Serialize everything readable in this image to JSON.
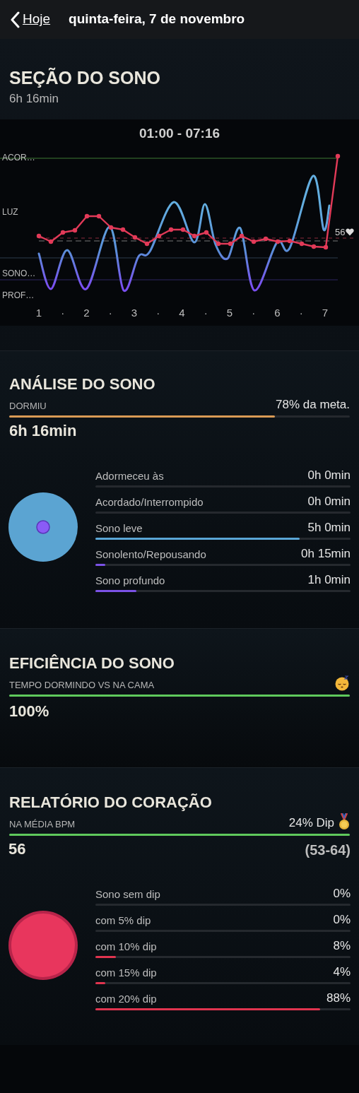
{
  "header": {
    "back_label": "Hoje",
    "title": "quinta-feira, 7 de novembro"
  },
  "sleep_session": {
    "title": "SEÇÃO DO SONO",
    "duration": "6h 16min",
    "chart": {
      "time_range": "01:00 - 07:16",
      "stage_labels": [
        "ACOR…",
        "LUZ",
        "SONO…",
        "PROF…"
      ],
      "x_labels": [
        "1",
        "·",
        "2",
        "·",
        "3",
        "·",
        "4",
        "·",
        "5",
        "·",
        "6",
        "·",
        "7"
      ],
      "heart_reading": "56"
    }
  },
  "sleep_analysis": {
    "title": "ANÁLISE DO SONO",
    "label": "DORMIU",
    "goal": "78% da meta.",
    "level": 0.78,
    "total": "6h 16min",
    "rows": [
      {
        "label": "Adormeceu às",
        "value": "0h 0min"
      },
      {
        "label": "Acordado/Interrompido",
        "value": "0h 0min"
      },
      {
        "label": "Sono leve",
        "value": "5h 0min",
        "level": 0.8,
        "color": "#5aa6d6"
      },
      {
        "label": "Sonolento/Repousando",
        "value": "0h 15min",
        "level": 0.04,
        "color": "#7b52e6"
      },
      {
        "label": "Sono profundo",
        "value": "1h 0min",
        "level": 0.16,
        "color": "#7b52e6"
      }
    ]
  },
  "efficiency": {
    "title": "EFICIÊNCIA DO SONO",
    "label": "TEMPO DORMINDO VS NA CAMA",
    "value": "100%",
    "level": 1
  },
  "heart_report": {
    "title": "RELATÓRIO DO CORAÇÃO",
    "label": "NA MÉDIA BPM",
    "dip": "24% Dip",
    "average": "56",
    "range": "(53-64)",
    "level": 1,
    "rows": [
      {
        "label": "Sono sem dip",
        "value": "0%"
      },
      {
        "label": "com 5% dip",
        "value": "0%"
      },
      {
        "label": "com 10% dip",
        "value": "8%",
        "level": 0.08,
        "color": "#e0344f"
      },
      {
        "label": "com 15% dip",
        "value": "4%",
        "level": 0.04,
        "color": "#e0344f"
      },
      {
        "label": "com 20% dip",
        "value": "88%",
        "level": 0.88,
        "color": "#e0344f"
      }
    ]
  }
}
